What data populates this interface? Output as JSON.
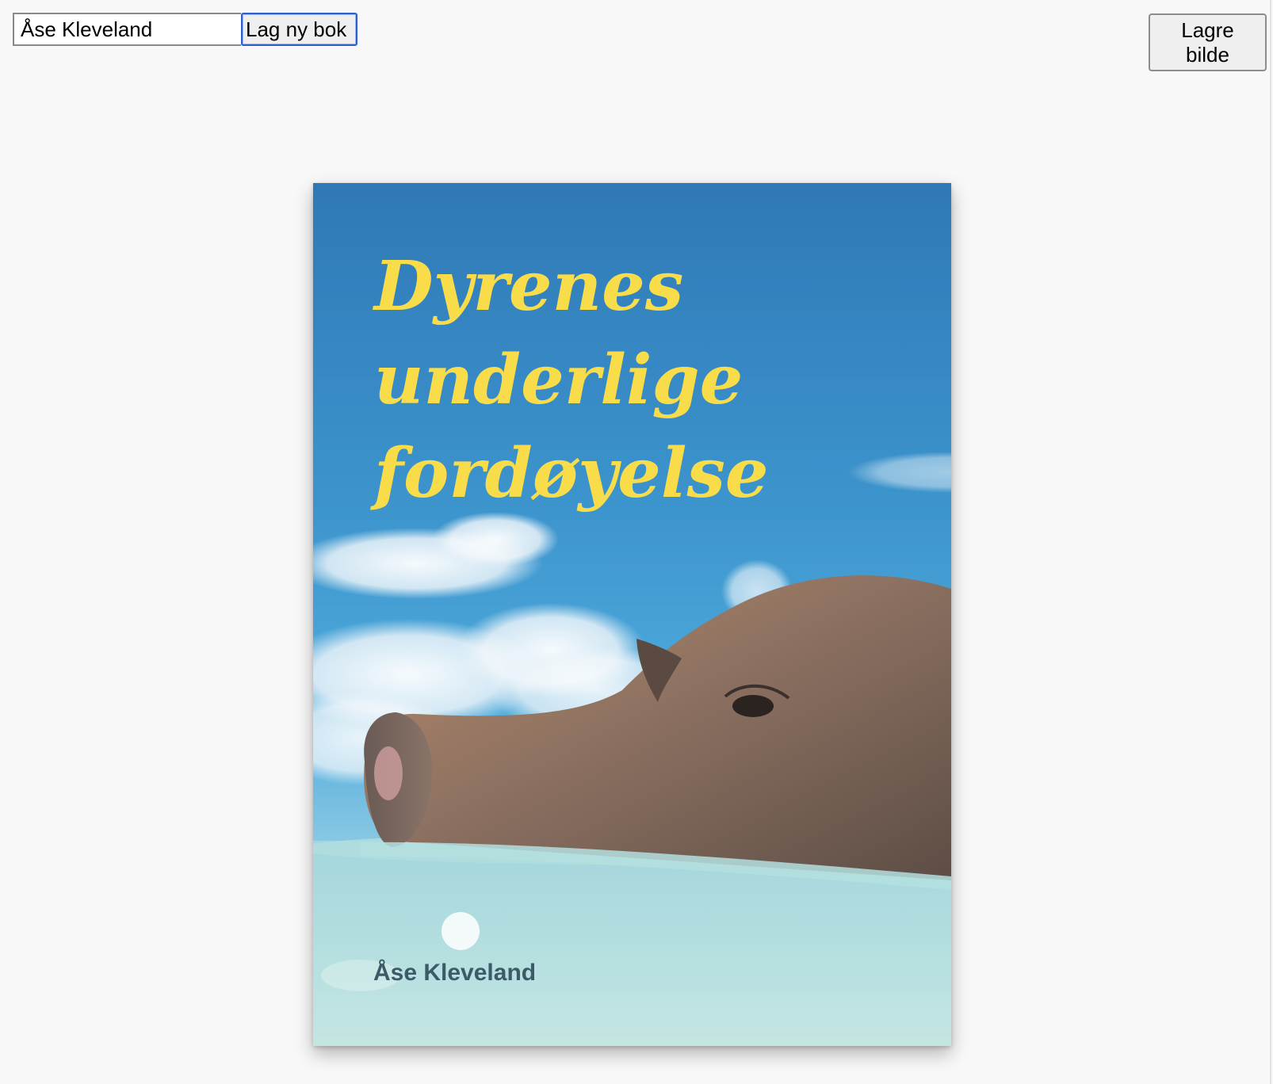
{
  "toolbar": {
    "author_input_value": "Åse Kleveland",
    "new_book_label": "Lag ny bok",
    "save_image_label": "Lagre bilde"
  },
  "cover": {
    "title_lines": [
      "Dyrenes",
      "underlige",
      "fordøyelse"
    ],
    "author": "Åse Kleveland",
    "title_color": "#f8dc4a",
    "author_color": "#3c5a68",
    "sky_color": "#3586c2",
    "water_color": "#b9e0df",
    "image_subject": "pig-swimming-icon"
  }
}
